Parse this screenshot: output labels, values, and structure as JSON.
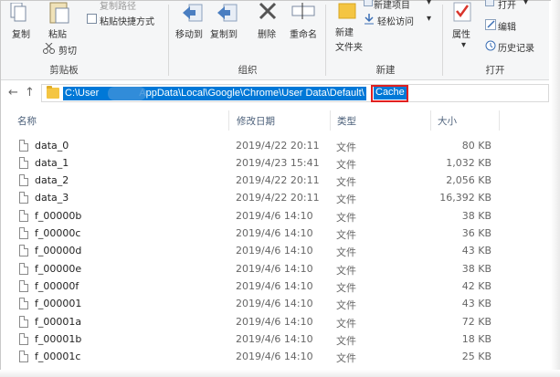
{
  "ribbon": {
    "clipboard": {
      "copy_label": "复制",
      "paste_label": "粘贴",
      "cut_label": "剪切",
      "copy_path_label": "复制路径",
      "paste_shortcut_label": "粘贴快捷方式",
      "group_label": "剪贴板"
    },
    "organize": {
      "move_to_label": "移动到",
      "copy_to_label": "复制到",
      "delete_label": "删除",
      "rename_label": "重命名",
      "group_label": "组织"
    },
    "new": {
      "new_folder_label": "新建\n文件夹",
      "new_item_label": "新建项目",
      "easy_access_label": "轻松访问",
      "group_label": "新建"
    },
    "open": {
      "properties_label": "属性",
      "open_label": "打开",
      "edit_label": "编辑",
      "history_label": "历史记录",
      "group_label": "打开"
    }
  },
  "address": {
    "path_prefix": "C:\\User",
    "path_middle": "AppData\\Local\\Google\\Chrome\\User Data\\Default\\",
    "path_last": "Cache"
  },
  "columns": {
    "name": "名称",
    "modified": "修改日期",
    "type": "类型",
    "size": "大小"
  },
  "files": [
    {
      "name": "data_0",
      "modified": "2019/4/22 20:11",
      "type": "文件",
      "size": "80 KB"
    },
    {
      "name": "data_1",
      "modified": "2019/4/23 15:41",
      "type": "文件",
      "size": "1,032 KB"
    },
    {
      "name": "data_2",
      "modified": "2019/4/22 20:11",
      "type": "文件",
      "size": "2,056 KB"
    },
    {
      "name": "data_3",
      "modified": "2019/4/22 20:11",
      "type": "文件",
      "size": "16,392 KB"
    },
    {
      "name": "f_00000b",
      "modified": "2019/4/6 14:10",
      "type": "文件",
      "size": "38 KB"
    },
    {
      "name": "f_00000c",
      "modified": "2019/4/6 14:10",
      "type": "文件",
      "size": "36 KB"
    },
    {
      "name": "f_00000d",
      "modified": "2019/4/6 14:10",
      "type": "文件",
      "size": "43 KB"
    },
    {
      "name": "f_00000e",
      "modified": "2019/4/6 14:10",
      "type": "文件",
      "size": "38 KB"
    },
    {
      "name": "f_00000f",
      "modified": "2019/4/6 14:10",
      "type": "文件",
      "size": "42 KB"
    },
    {
      "name": "f_000001",
      "modified": "2019/4/6 14:10",
      "type": "文件",
      "size": "43 KB"
    },
    {
      "name": "f_00001a",
      "modified": "2019/4/6 14:10",
      "type": "文件",
      "size": "72 KB"
    },
    {
      "name": "f_00001b",
      "modified": "2019/4/6 14:10",
      "type": "文件",
      "size": "18 KB"
    },
    {
      "name": "f_00001c",
      "modified": "2019/4/6 14:10",
      "type": "文件",
      "size": "25 KB"
    }
  ],
  "colors": {
    "selection": "#0078d7",
    "highlight_box": "#e02020",
    "folder": "#f4c542"
  }
}
